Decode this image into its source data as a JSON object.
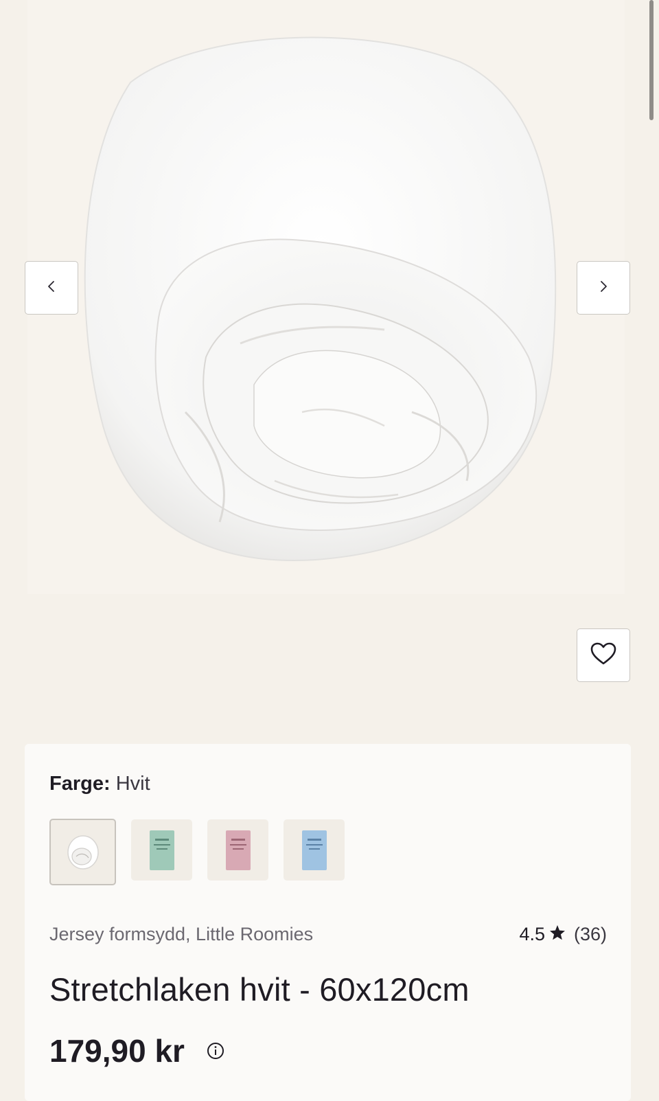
{
  "gallery": {
    "image_alt": "Rolled white fitted jersey sheet",
    "prev_icon": "chevron-left-icon",
    "next_icon": "chevron-right-icon",
    "favorite_icon": "heart-icon"
  },
  "product": {
    "color_label": "Farge:",
    "color_value": "Hvit",
    "swatches": [
      {
        "name": "Hvit",
        "color": "#ffffff",
        "selected": true
      },
      {
        "name": "Grønn",
        "color": "#9fc9b8",
        "selected": false
      },
      {
        "name": "Rosa",
        "color": "#d8a9b4",
        "selected": false
      },
      {
        "name": "Blå",
        "color": "#9fc3e2",
        "selected": false
      }
    ],
    "brand_line": "Jersey formsydd, Little Roomies",
    "rating": "4.5",
    "rating_count": "(36)",
    "title": "Stretchlaken hvit - 60x120cm",
    "price": "179,90 kr"
  },
  "colors": {
    "page_bg": "#f5f1ea",
    "card_bg": "#fbfaf8",
    "text": "#1f1c24",
    "muted": "#6b6870"
  }
}
